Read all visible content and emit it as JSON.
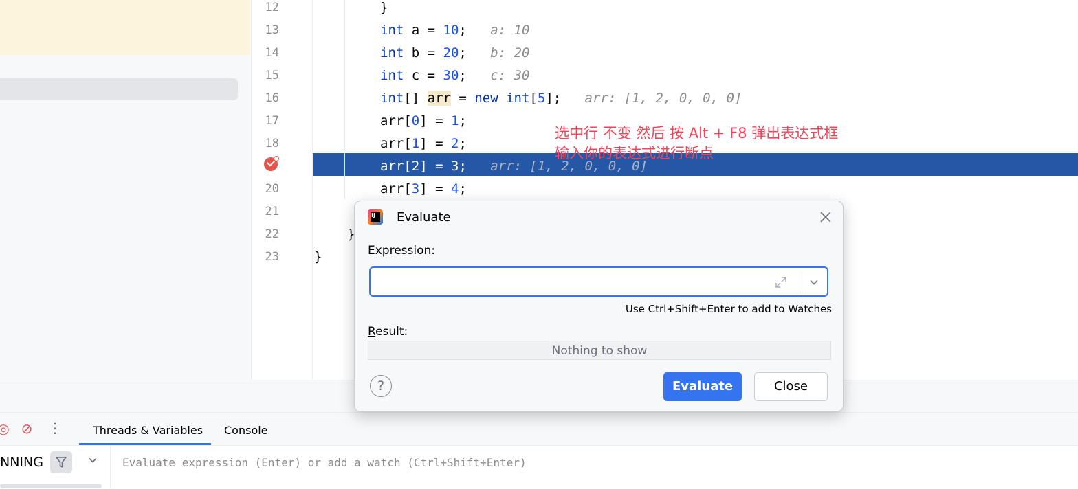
{
  "gutter": {
    "line_numbers": [
      "12",
      "13",
      "14",
      "15",
      "16",
      "17",
      "18",
      "20",
      "21",
      "22",
      "23"
    ]
  },
  "code": {
    "l12": "}",
    "l13": {
      "kw": "int",
      "rest": " a = ",
      "num": "10",
      "end": ";",
      "hint": "a: 10"
    },
    "l14": {
      "kw": "int",
      "rest": " b = ",
      "num": "20",
      "end": ";",
      "hint": "b: 20"
    },
    "l15": {
      "kw": "int",
      "rest": " c = ",
      "num": "30",
      "end": ";",
      "hint": "c: 30"
    },
    "l16": {
      "kw": "int",
      "br": "[] ",
      "var": "arr",
      "eq": " = ",
      "kw2": "new",
      "sp": " ",
      "kw3": "int",
      "open": "[",
      "num": "5",
      "close": "];",
      "hint": "arr: [1, 2, 0, 0, 0]"
    },
    "l17": {
      "a": "arr[",
      "num": "0",
      "b": "] = ",
      "num2": "1",
      "end": ";"
    },
    "l18": {
      "a": "arr[",
      "num": "1",
      "b": "] = ",
      "num2": "2",
      "end": ";"
    },
    "l19": {
      "a": "arr[",
      "num": "2",
      "b": "] = ",
      "num2": "3",
      "end": ";",
      "hint": "arr: [1, 2, 0, 0, 0]"
    },
    "l20": {
      "a": "arr[",
      "num": "3",
      "b": "] = ",
      "num2": "4",
      "end": ";"
    },
    "l22": "}",
    "l23": "}"
  },
  "annotation": {
    "line1": "选中行 不变 然后 按 Alt + F8 弹出表达式框",
    "line2": "输入你的表达式进行断点"
  },
  "dialog": {
    "title": "Evaluate",
    "expression_label": "Expression:",
    "expression_value": "",
    "watch_hint": "Use Ctrl+Shift+Enter to add to Watches",
    "result_label_underlined": "R",
    "result_label_rest": "esult:",
    "result_text": "Nothing to show",
    "help": "?",
    "evaluate_pre": "E",
    "evaluate_u": "v",
    "evaluate_post": "aluate",
    "close": "Close"
  },
  "debugger": {
    "tabs": [
      "Threads & Variables",
      "Console"
    ],
    "active_tab": "Threads & Variables",
    "status": "NNING",
    "evaluate_placeholder": "Evaluate expression (Enter) or add a watch (Ctrl+Shift+Enter)"
  },
  "colors": {
    "highlight": "#2557a7",
    "accent": "#3574f0",
    "annotation": "#f0455a",
    "breakpoint": "#e5534b"
  }
}
